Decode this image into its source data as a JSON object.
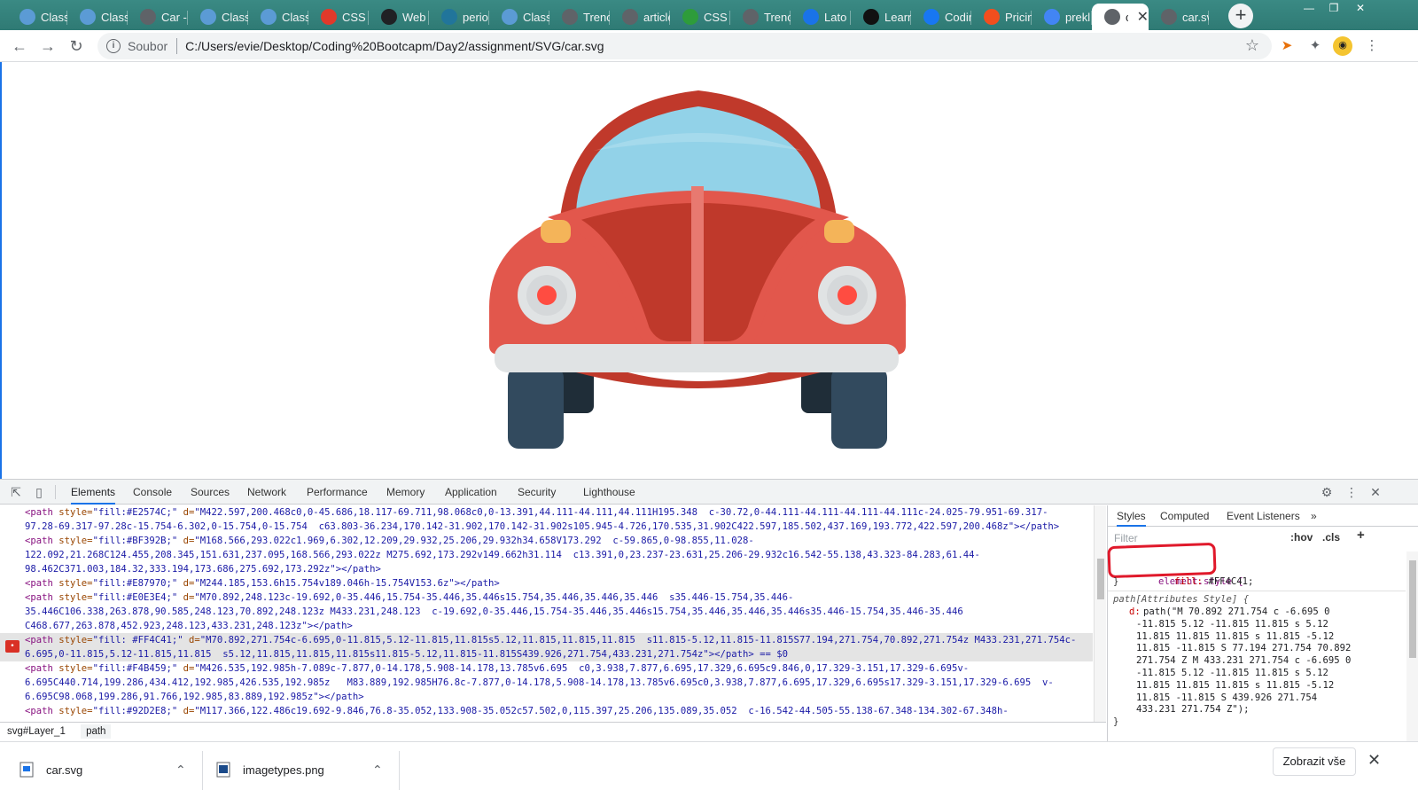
{
  "tabs": [
    {
      "title": "Class",
      "icon": "y-icon",
      "color": "#5b9bd5"
    },
    {
      "title": "Class",
      "icon": "y-icon",
      "color": "#5b9bd5"
    },
    {
      "title": "Car -",
      "icon": "globe-icon",
      "color": "#5f6368"
    },
    {
      "title": "Class",
      "icon": "y-icon",
      "color": "#5b9bd5"
    },
    {
      "title": "Class",
      "icon": "y-icon",
      "color": "#5b9bd5"
    },
    {
      "title": "CSS B",
      "icon": "css-icon",
      "color": "#e0392b"
    },
    {
      "title": "Web",
      "icon": "web-icon",
      "color": "#202124"
    },
    {
      "title": "perio",
      "icon": "wordpress-icon",
      "color": "#21759b"
    },
    {
      "title": "Class",
      "icon": "y-icon",
      "color": "#5b9bd5"
    },
    {
      "title": "Trenc",
      "icon": "globe-icon",
      "color": "#5f6368"
    },
    {
      "title": "article",
      "icon": "globe-icon",
      "color": "#5f6368"
    },
    {
      "title": "CSS L",
      "icon": "css-layout-icon",
      "color": "#2e9c3b"
    },
    {
      "title": "Trenc",
      "icon": "globe-icon",
      "color": "#5f6368"
    },
    {
      "title": "Lato",
      "icon": "f-icon",
      "color": "#1a73e8"
    },
    {
      "title": "Learn",
      "icon": "learn-icon",
      "color": "#111111"
    },
    {
      "title": "Codin",
      "icon": "facebook-icon",
      "color": "#1877f2"
    },
    {
      "title": "Pricin",
      "icon": "figma-icon",
      "color": "#f24e1e"
    },
    {
      "title": "prekl",
      "icon": "google-icon",
      "color": "#4285f4"
    },
    {
      "title": "ca",
      "icon": "globe-icon",
      "color": "#5f6368",
      "active": true
    },
    {
      "title": "car.sv",
      "icon": "globe-icon",
      "color": "#5f6368"
    }
  ],
  "address": {
    "scheme_label": "Soubor",
    "url": "C:/Users/evie/Desktop/Coding%20Bootcapm/Day2/assignment/SVG/car.svg"
  },
  "devtools": {
    "tabs": [
      "Elements",
      "Console",
      "Sources",
      "Network",
      "Performance",
      "Memory",
      "Application",
      "Security",
      "Lighthouse"
    ],
    "active_tab": "Elements",
    "code_lines": [
      {
        "pre": "<path ",
        "attr": "style=",
        "val": "\"fill:#E2574C;\"",
        "attr2": " d=",
        "val2": "\"M422.597,200.468c0,0-45.686,18.117-69.711,98.068c0,0-13.391,44.111-44.111,44.111H195.348  c-30.72,0-44.111-44.111-44.111-44.111c-24.025-79.951-69.317-"
      },
      {
        "pre": "",
        "attr": "",
        "val": "97.28-69.317-97.28c-15.754-6.302,0-15.754,0-15.754  c63.803-36.234,170.142-31.902,170.142-31.902s105.945-4.726,170.535,31.902C422.597,185.502,437.169,193.772,422.597,200.468z\"",
        "attr2": "",
        "val2": "></path>"
      },
      {
        "pre": "<path ",
        "attr": "style=",
        "val": "\"fill:#BF392B;\"",
        "attr2": " d=",
        "val2": "\"M168.566,293.022c1.969,6.302,12.209,29.932,25.206,29.932h34.658V173.292  c-59.865,0-98.855,11.028-"
      },
      {
        "pre": "",
        "attr": "",
        "val": "122.092,21.268C124.455,208.345,151.631,237.095,168.566,293.022z M275.692,173.292v149.662h31.114  c13.391,0,23.237-23.631,25.206-29.932c16.542-55.138,43.323-84.283,61.44-",
        "attr2": "",
        "val2": ""
      },
      {
        "pre": "",
        "attr": "",
        "val": "98.462C371.003,184.32,333.194,173.686,275.692,173.292z\"",
        "attr2": "",
        "val2": "></path>"
      },
      {
        "pre": "<path ",
        "attr": "style=",
        "val": "\"fill:#E87970;\"",
        "attr2": " d=",
        "val2": "\"M244.185,153.6h15.754v189.046h-15.754V153.6z\"></path>"
      },
      {
        "pre": "<path ",
        "attr": "style=",
        "val": "\"fill:#E0E3E4;\"",
        "attr2": " d=",
        "val2": "\"M70.892,248.123c-19.692,0-35.446,15.754-35.446,35.446s15.754,35.446,35.446,35.446  s35.446-15.754,35.446-"
      },
      {
        "pre": "",
        "attr": "",
        "val": "35.446C106.338,263.878,90.585,248.123,70.892,248.123z M433.231,248.123  c-19.692,0-35.446,15.754-35.446,35.446s15.754,35.446,35.446,35.446s35.446-15.754,35.446-35.446",
        "attr2": "",
        "val2": ""
      },
      {
        "pre": "",
        "attr": "",
        "val": "C468.677,263.878,452.923,248.123,433.231,248.123z\"",
        "attr2": "",
        "val2": "></path>"
      },
      {
        "pre": "<path ",
        "attr": "style=",
        "val": "\"fill: #FF4C41;\"",
        "attr2": " d=",
        "val2": "\"M70.892,271.754c-6.695,0-11.815,5.12-11.815,11.815s5.12,11.815,11.815,11.815  s11.815-5.12,11.815-11.815S77.194,271.754,70.892,271.754z M433.231,271.754c-",
        "selected": true
      },
      {
        "pre": "",
        "attr": "",
        "val": "6.695,0-11.815,5.12-11.815,11.815  s5.12,11.815,11.815,11.815s11.815-5.12,11.815-11.815S439.926,271.754,433.231,271.754z\"",
        "attr2": "",
        "val2": "></path> == $0",
        "selected": true
      },
      {
        "pre": "<path ",
        "attr": "style=",
        "val": "\"fill:#F4B459;\"",
        "attr2": " d=",
        "val2": "\"M426.535,192.985h-7.089c-7.877,0-14.178,5.908-14.178,13.785v6.695  c0,3.938,7.877,6.695,17.329,6.695c9.846,0,17.329-3.151,17.329-6.695v-"
      },
      {
        "pre": "",
        "attr": "",
        "val": "6.695C440.714,199.286,434.412,192.985,426.535,192.985z   M83.889,192.985H76.8c-7.877,0-14.178,5.908-14.178,13.785v6.695c0,3.938,7.877,6.695,17.329,6.695s17.329-3.151,17.329-6.695  v-",
        "attr2": "",
        "val2": ""
      },
      {
        "pre": "",
        "attr": "",
        "val": "6.695C98.068,199.286,91.766,192.985,83.889,192.985z\"",
        "attr2": "",
        "val2": "></path>"
      },
      {
        "pre": "<path ",
        "attr": "style=",
        "val": "\"fill:#92D2E8;\"",
        "attr2": " d=",
        "val2": "\"M117.366,122.486c19.692-9.846,76.8-35.052,133.908-35.052c57.502,0,115.397,25.206,135.089,35.052  c-16.542-44.505-55.138-67.348-134.302-67.348h-"
      }
    ],
    "breadcrumbs": [
      "svg#Layer_1",
      "path"
    ],
    "styles_tabs": [
      "Styles",
      "Computed",
      "Event Listeners",
      "»"
    ],
    "filter_placeholder": "Filter",
    "filter_buttons": [
      ":hov",
      ".cls",
      "+"
    ],
    "element_style_selector": "element.style {",
    "element_style_prop": "fill:",
    "element_style_value": "#FF4C41;",
    "attr_selector": "path[Attributes Style] {",
    "attr_prop": "d:",
    "attr_value_lines": [
      "path(\"M 70.892 271.754 c -6.695 0",
      "-11.815 5.12 -11.815 11.815 s 5.12",
      "11.815 11.815 11.815 s 11.815 -5.12",
      "11.815 -11.815 S 77.194 271.754 70.892",
      "271.754 Z M 433.231 271.754 c -6.695 0",
      "-11.815 5.12 -11.815 11.815 s 5.12",
      "11.815 11.815 11.815 s 11.815 -5.12",
      "11.815 -11.815 S 439.926 271.754",
      "433.231 271.754 Z\");"
    ],
    "close_brace": "}"
  },
  "downloads": {
    "items": [
      "car.svg",
      "imagetypes.png"
    ],
    "show_all": "Zobrazit vše"
  },
  "car_colors": {
    "body": "#E2574C",
    "body_dark": "#BF392B",
    "roof": "#C0392B",
    "glass": "#92D2E8",
    "stripe": "#E87970",
    "headlight_ring": "#E0E3E4",
    "headlight": "#FF4C41",
    "indicator": "#F4B459",
    "bumper": "#E0E3E4",
    "tire": "#324A5E",
    "tire_dark": "#1F2D38"
  }
}
